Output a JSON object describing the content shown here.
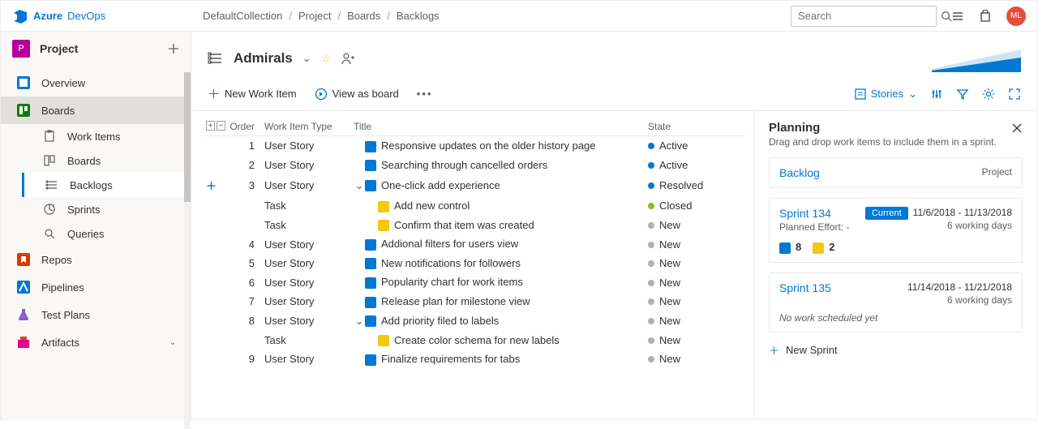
{
  "brand": {
    "azure": "Azure",
    "devops": "DevOps"
  },
  "breadcrumbs": [
    "DefaultCollection",
    "Project",
    "Boards",
    "Backlogs"
  ],
  "search": {
    "placeholder": "Search"
  },
  "avatar": "ML",
  "project": {
    "name": "Project",
    "letter": "P"
  },
  "nav": {
    "overview": "Overview",
    "boards": "Boards",
    "boards_children": {
      "work_items": "Work Items",
      "boards": "Boards",
      "backlogs": "Backlogs",
      "sprints": "Sprints",
      "queries": "Queries"
    },
    "repos": "Repos",
    "pipelines": "Pipelines",
    "test_plans": "Test Plans",
    "artifacts": "Artifacts"
  },
  "team": {
    "name": "Admirals"
  },
  "toolbar": {
    "new_item": "New Work Item",
    "view_board": "View as board",
    "stories": "Stories"
  },
  "grid": {
    "headers": {
      "order": "Order",
      "type": "Work Item Type",
      "title": "Title",
      "state": "State"
    },
    "rows": [
      {
        "order": "1",
        "type": "User Story",
        "wi": "story",
        "title": "Responsive updates on the older history page",
        "state": "Active",
        "dot": "active"
      },
      {
        "order": "2",
        "type": "User Story",
        "wi": "story",
        "title": "Searching through cancelled orders",
        "state": "Active",
        "dot": "active"
      },
      {
        "order": "3",
        "type": "User Story",
        "wi": "story",
        "title": "One-click add experience",
        "state": "Resolved",
        "dot": "resolved",
        "expandable": true,
        "showAdd": true
      },
      {
        "order": "",
        "type": "Task",
        "wi": "task",
        "title": "Add new control",
        "state": "Closed",
        "dot": "closed",
        "indent": 1
      },
      {
        "order": "",
        "type": "Task",
        "wi": "task",
        "title": "Confirm that item was created",
        "state": "New",
        "dot": "new",
        "indent": 1
      },
      {
        "order": "4",
        "type": "User Story",
        "wi": "story",
        "title": "Addional filters for users view",
        "state": "New",
        "dot": "new"
      },
      {
        "order": "5",
        "type": "User Story",
        "wi": "story",
        "title": "New notifications for followers",
        "state": "New",
        "dot": "new"
      },
      {
        "order": "6",
        "type": "User Story",
        "wi": "story",
        "title": "Popularity chart for work items",
        "state": "New",
        "dot": "new"
      },
      {
        "order": "7",
        "type": "User Story",
        "wi": "story",
        "title": "Release plan for milestone view",
        "state": "New",
        "dot": "new"
      },
      {
        "order": "8",
        "type": "User Story",
        "wi": "story",
        "title": "Add priority filed to labels",
        "state": "New",
        "dot": "new",
        "expandable": true
      },
      {
        "order": "",
        "type": "Task",
        "wi": "task",
        "title": "Create color schema for new labels",
        "state": "New",
        "dot": "new",
        "indent": 1
      },
      {
        "order": "9",
        "type": "User Story",
        "wi": "story",
        "title": "Finalize requirements for tabs",
        "state": "New",
        "dot": "new"
      }
    ]
  },
  "planning": {
    "title": "Planning",
    "subtitle": "Drag and drop work items to include them in a sprint.",
    "backlog": {
      "title": "Backlog",
      "project": "Project"
    },
    "sprint134": {
      "title": "Sprint 134",
      "current": "Current",
      "dates": "11/6/2018 - 11/13/2018",
      "effort": "Planned Effort: -",
      "days": "6 working days",
      "story_count": "8",
      "task_count": "2"
    },
    "sprint135": {
      "title": "Sprint 135",
      "dates": "11/14/2018 - 11/21/2018",
      "days": "6 working days",
      "empty": "No work scheduled yet"
    },
    "new_sprint": "New Sprint"
  }
}
